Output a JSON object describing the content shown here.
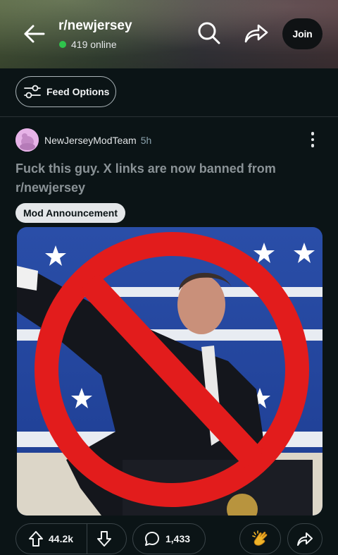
{
  "header": {
    "subreddit": "r/newjersey",
    "online_count": "419 online",
    "join_label": "Join",
    "icons": [
      "back-arrow-icon",
      "search-icon",
      "share-icon"
    ]
  },
  "feed": {
    "options_label": "Feed Options"
  },
  "post": {
    "author": "NewJerseyModTeam",
    "age": "5h",
    "title": "Fuck this guy. X links are now banned from r/newjersey",
    "flair": "Mod Announcement",
    "image_description_icon": "prohibition-sign-icon",
    "actions": {
      "upvotes": "44.2k",
      "comments": "1,433"
    }
  },
  "colors": {
    "background": "#0b1416",
    "online_dot": "#2fc44c",
    "prohibition_red": "#e21c1c",
    "flair_bg": "#e4e7e9",
    "avatar_bg": "#e7b3e8"
  }
}
